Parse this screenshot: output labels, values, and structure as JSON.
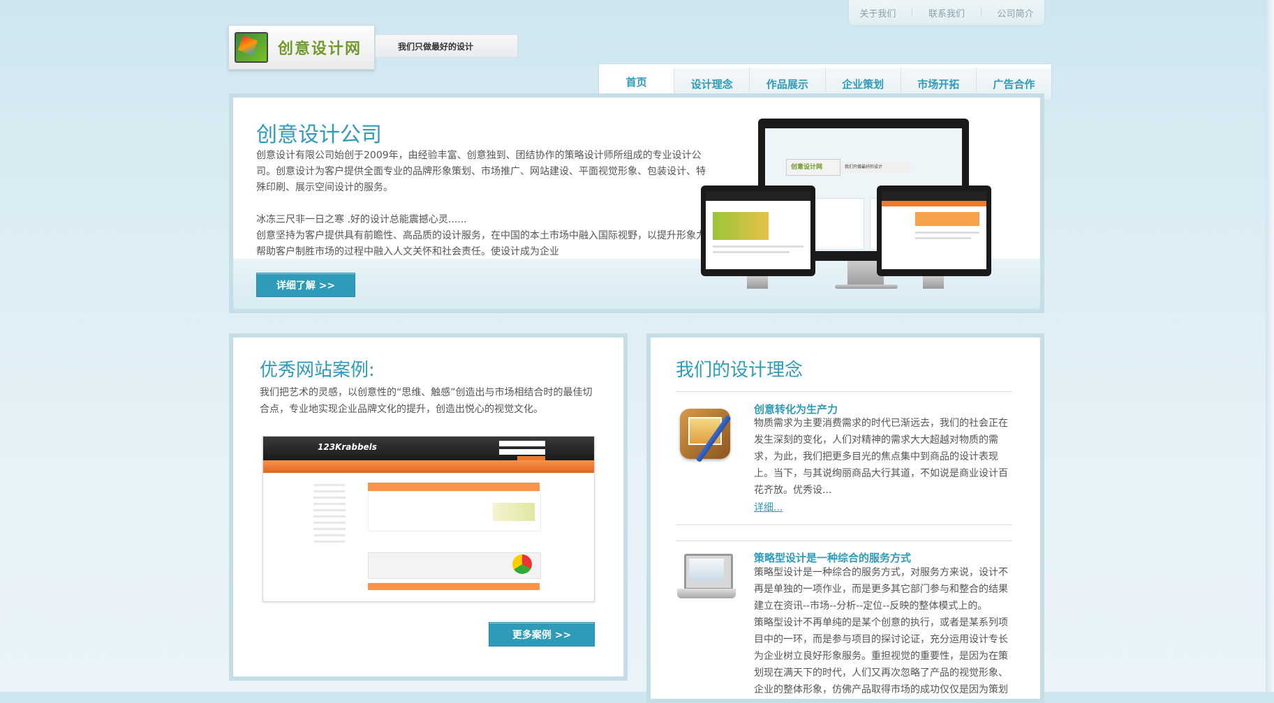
{
  "top_links": [
    "关于我们",
    "联系我们",
    "公司简介"
  ],
  "logo": {
    "text": "创意设计网"
  },
  "slogan": "我们只做最好的设计",
  "nav": [
    "首页",
    "设计理念",
    "作品展示",
    "企业策划",
    "市场开拓",
    "广告合作"
  ],
  "hero": {
    "title": "创意设计公司",
    "p1": "创意设计有限公司始创于2009年，由经验丰富、创意独到、团结协作的策略设计师所组成的专业设计公司。创意设计为客户提供全面专业的品牌形象策划、市场推广、网站建设、平面视觉形象、包装设计、特殊印刷、展示空间设计的服务。",
    "p2": "冰冻三尺非一日之寒 .好的设计总能震撼心灵......",
    "p3": "创意坚持为客户提供具有前瞻性、高品质的设计服务，在中国的本土市场中融入国际视野，以提升形象力帮助客户制胜市场的过程中融入人文关怀和社会责任。使设计成为企业",
    "button": "详细了解 >>",
    "screen_logo": "创意设计网",
    "screen_slogan": "我们只做最好的设计"
  },
  "cases": {
    "title": "优秀网站案例:",
    "desc": "我们把艺术的灵感，以创意性的“思维、触感”创造出与市场相结合时的最佳切合点，专业地实现企业品牌文化的提升，创造出悦心的视觉文化。",
    "screenshot_brand": "123Krabbels",
    "button": "更多案例 >>"
  },
  "ideas": {
    "title": "我们的设计理念",
    "items": [
      {
        "title": "创意转化为生产力",
        "body": "物质需求为主要消费需求的时代已渐远去，我们的社会正在发生深刻的变化，人们对精神的需求大大超越对物质的需求，为此，我们把更多目光的焦点集中到商品的设计表现上。当下，与其说绚丽商品大行其道，不如说是商业设计百花齐放。优秀设...",
        "more": "详细..."
      },
      {
        "title": "策略型设计是一种综合的服务方式",
        "body1": "策略型设计是一种综合的服务方式，对服务方来说，设计不再是单独的一项作业，而是更多其它部门参与和整合的结果建立在资讯--市场--分析--定位--反映的整体模式上的。",
        "body2": "策略型设计不再单纯的是某个创意的执行，或者是某系列项目中的一环，而是参与项目的探讨论证，充分运用设计专长为企业树立良好形象服务。重担视觉的重要性，是因为在策划现在满天下的时代，人们又再次忽略了产品的视觉形象、企业的整体形象，仿佛产品取得市场的成功仅仅是因为策划"
      }
    ]
  },
  "colors": {
    "accent": "#2e9bb8",
    "border": "#c5dde7"
  }
}
